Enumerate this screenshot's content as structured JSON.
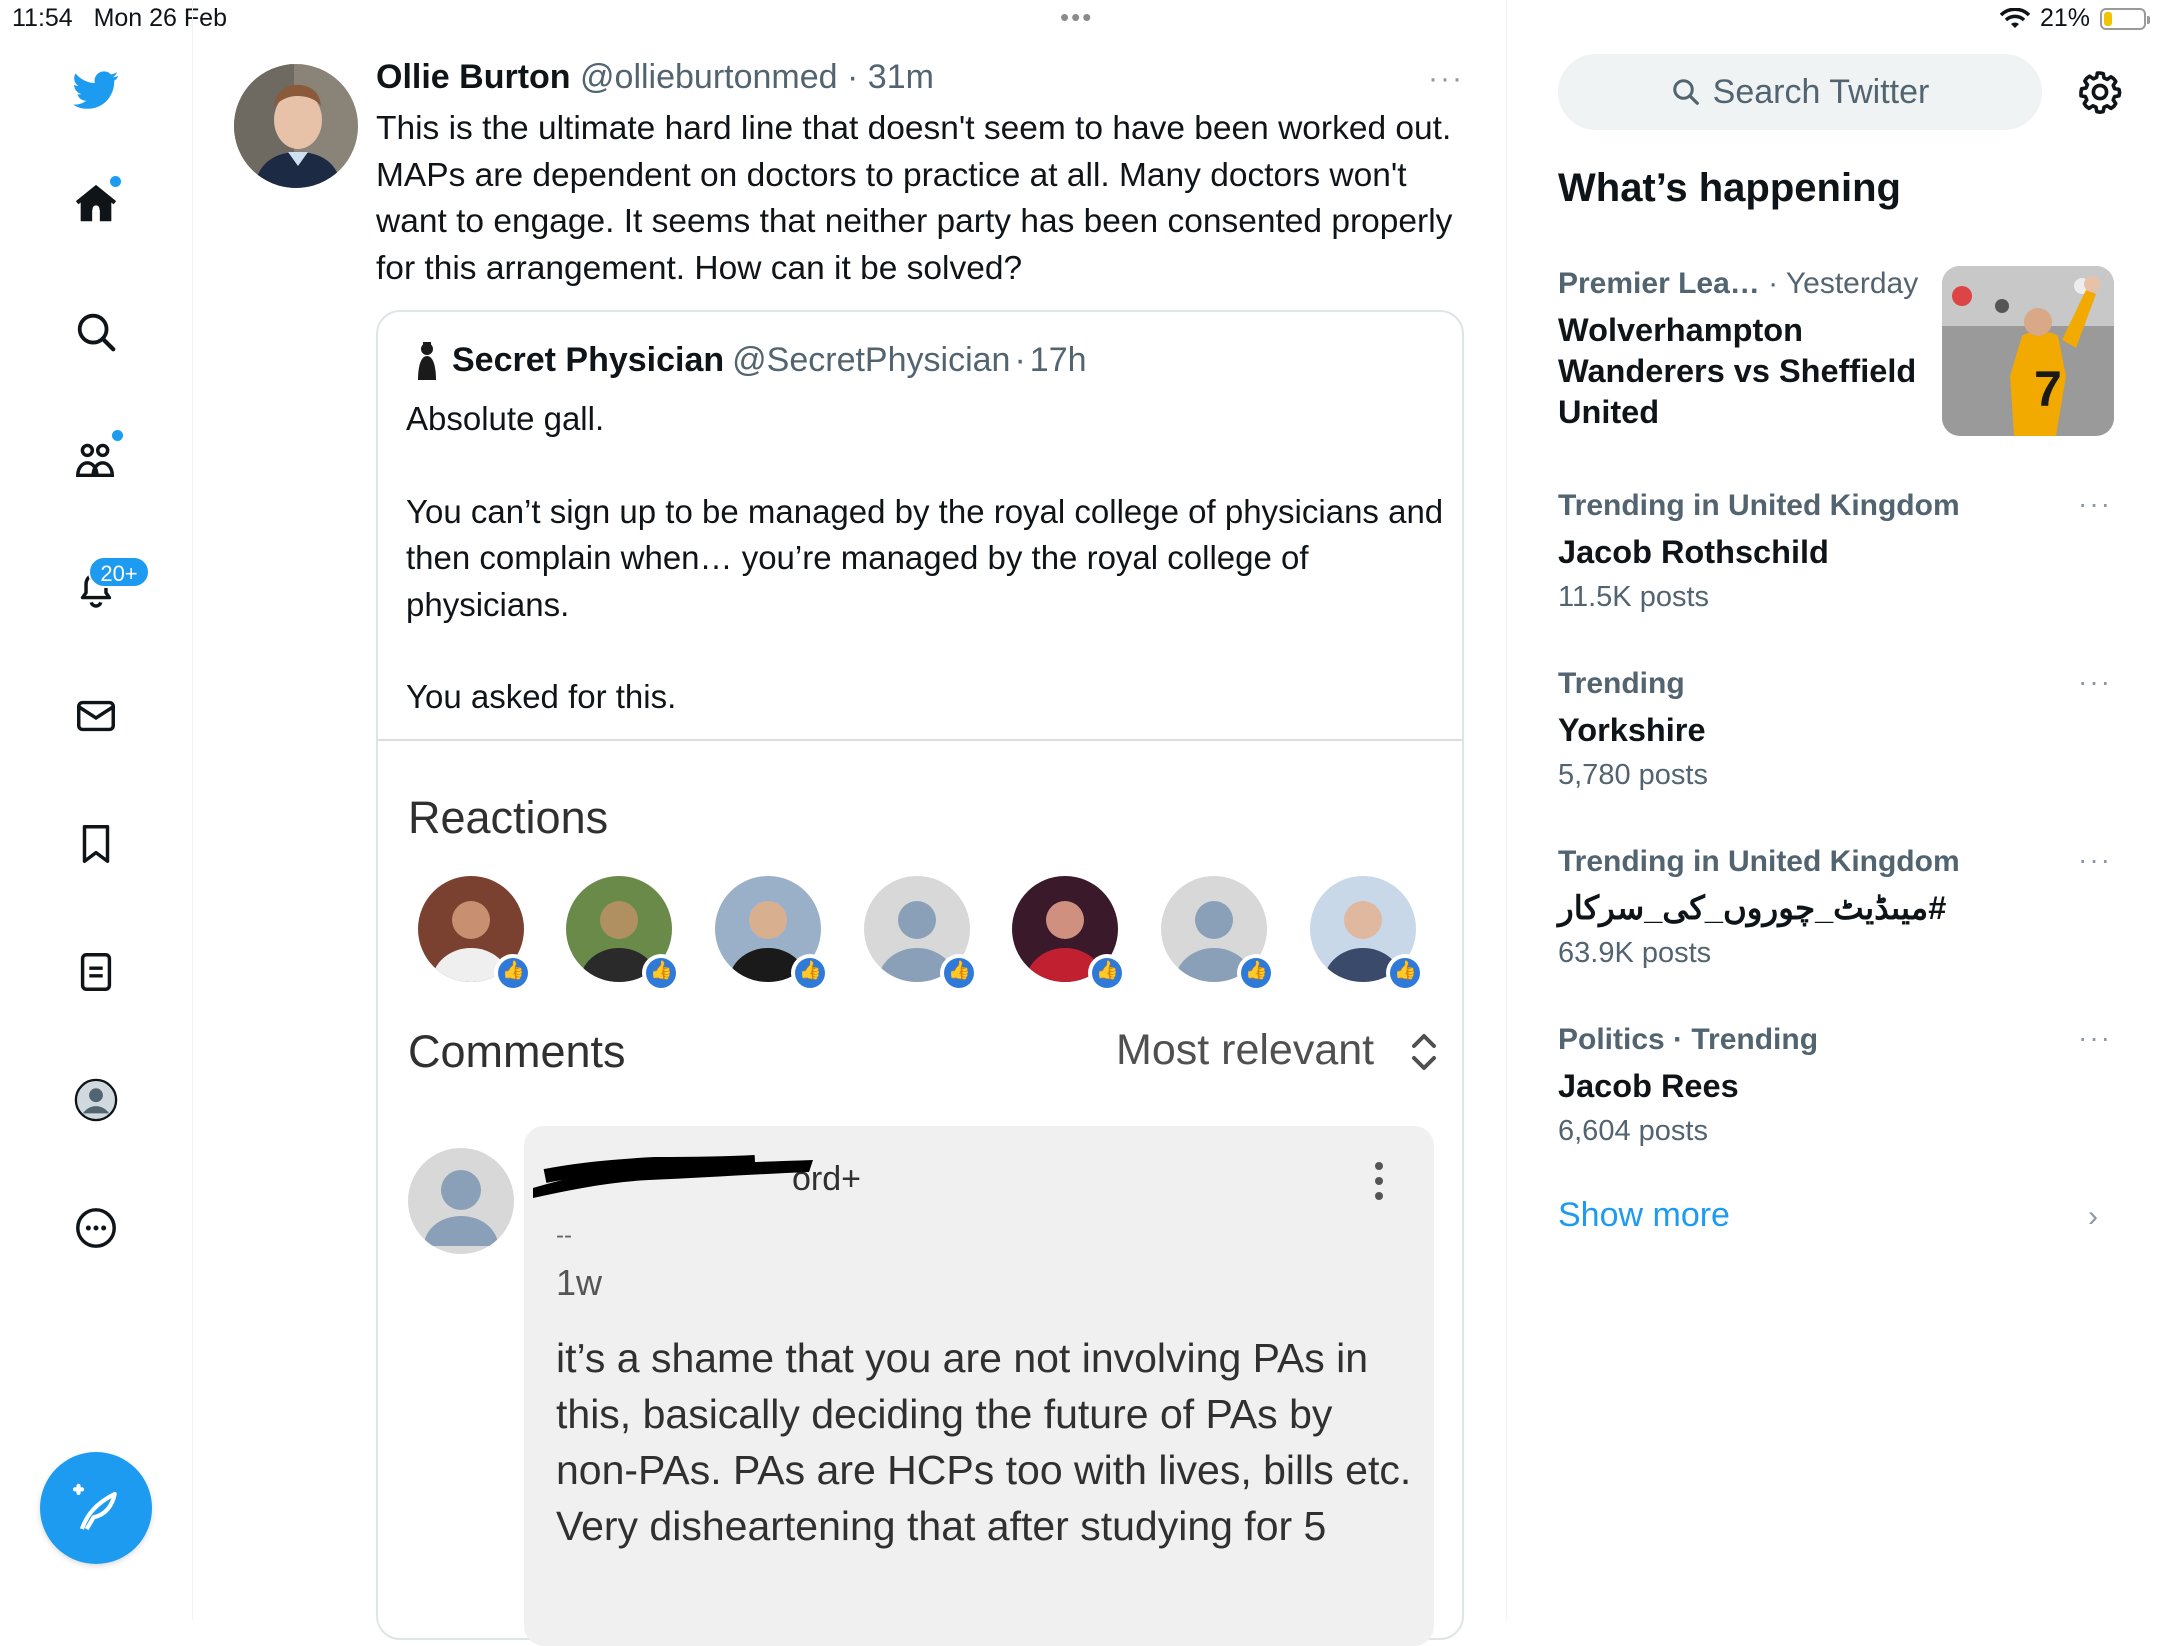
{
  "status_bar": {
    "time": "11:54",
    "date": "Mon 26 Feb",
    "dots": "•••",
    "battery": "21%",
    "battery_level": 0.21,
    "wifi_icon": "wifi-icon"
  },
  "nav": {
    "items": [
      {
        "name": "logo",
        "icon": "twitter-bird-icon"
      },
      {
        "name": "home",
        "icon": "home-icon"
      },
      {
        "name": "explore",
        "icon": "search-icon"
      },
      {
        "name": "communities",
        "icon": "people-icon"
      },
      {
        "name": "notifications",
        "icon": "bell-icon"
      },
      {
        "name": "messages",
        "icon": "mail-icon"
      },
      {
        "name": "bookmarks",
        "icon": "bookmark-icon"
      },
      {
        "name": "lists",
        "icon": "list-icon"
      },
      {
        "name": "profile",
        "icon": "profile-icon"
      },
      {
        "name": "more",
        "icon": "more-circle-icon"
      }
    ],
    "notifications_badge": "20+",
    "compose_icon": "compose-feather-icon",
    "accent": "#1d9bf0"
  },
  "tweet": {
    "name": "Ollie Burton",
    "handle": "@ollieburtonmed",
    "sep": "·",
    "time": "31m",
    "more": "···",
    "text": "This is the ultimate hard line that doesn't seem to have been worked out. MAPs are dependent on doctors to practice at all. Many doctors won't want to engage. It seems that neither party has been consented properly for this arrangement. How can it be solved?"
  },
  "quote": {
    "name": "Secret Physician",
    "handle": "@SecretPhysician",
    "sep": "·",
    "time": "17h",
    "paragraphs": [
      "Absolute gall.",
      "You can’t sign up to be managed by the royal college of physicians and then complain when… you’re managed by the royal college of physicians.",
      "You asked for this."
    ],
    "embedded": {
      "reactions_title": "Reactions",
      "comments_title": "Comments",
      "sort_label": "Most relevant",
      "comment": {
        "name_suffix": "ord+",
        "dash": "--",
        "time": "1w",
        "text": "it’s a shame that you are not involving PAs in this, basically deciding the future of PAs by non-PAs. PAs are HCPs too with lives, bills etc.\nVery disheartening that after studying for 5"
      }
    }
  },
  "sidebar": {
    "search_placeholder": "Search Twitter",
    "whats_happening": "What’s happening",
    "trends": [
      {
        "category": "Premier Lea…",
        "meta2": "· Yesterday",
        "title": "Wolverhampton Wanderers vs Sheffield United",
        "count": ""
      },
      {
        "category": "Trending in United Kingdom",
        "meta2": "",
        "title": "Jacob Rothschild",
        "count": "11.5K posts"
      },
      {
        "category": "Trending",
        "meta2": "",
        "title": "Yorkshire",
        "count": "5,780 posts"
      },
      {
        "category": "Trending in United Kingdom",
        "meta2": "",
        "title": "#میںڈیٹ_چوروں_کی_سرکار",
        "count": "63.9K posts"
      },
      {
        "category": "Politics · Trending",
        "meta2": "",
        "title": "Jacob Rees",
        "count": "6,604 posts"
      }
    ],
    "trend_more": "···",
    "show_more": "Show more",
    "chevron": "›"
  }
}
